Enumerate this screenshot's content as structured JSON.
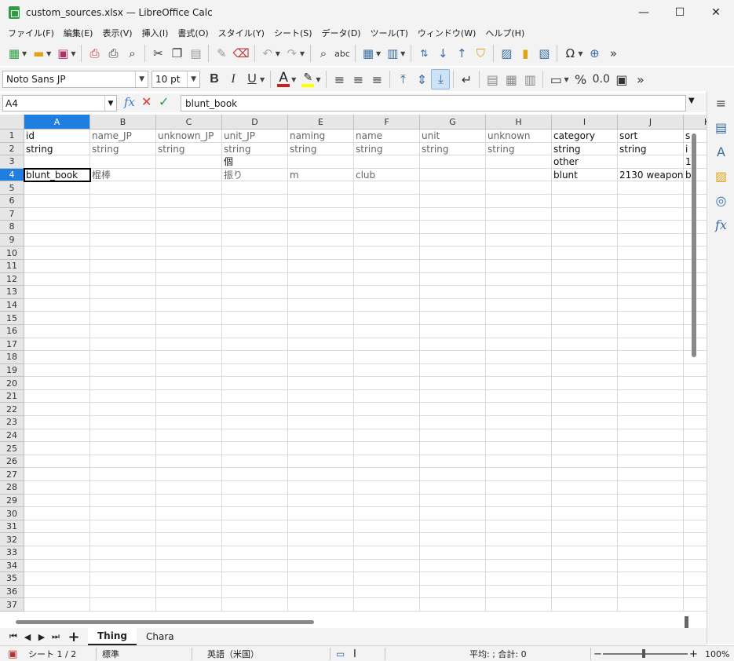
{
  "window": {
    "title": "custom_sources.xlsx — LibreOffice Calc",
    "minimize": "—",
    "maximize": "☐",
    "close": "✕"
  },
  "menu": [
    "ファイル(F)",
    "編集(E)",
    "表示(V)",
    "挿入(I)",
    "書式(O)",
    "スタイル(Y)",
    "シート(S)",
    "データ(D)",
    "ツール(T)",
    "ウィンドウ(W)",
    "ヘルプ(H)"
  ],
  "toolbar2": {
    "font_name": "Noto Sans JP",
    "font_size": "10 pt",
    "bold": "B",
    "italic": "I",
    "underline": "U",
    "font_color_letter": "A",
    "font_color": "#c9211e",
    "highlight_color": "#ffff00",
    "percent": "%",
    "decimal": "0.0"
  },
  "formula_bar": {
    "name_box": "A4",
    "content": "blunt_book"
  },
  "columns": [
    {
      "letter": "A",
      "selected": true
    },
    {
      "letter": "B",
      "selected": false
    },
    {
      "letter": "C",
      "selected": false
    },
    {
      "letter": "D",
      "selected": false
    },
    {
      "letter": "E",
      "selected": false
    },
    {
      "letter": "F",
      "selected": false
    },
    {
      "letter": "G",
      "selected": false
    },
    {
      "letter": "H",
      "selected": false
    },
    {
      "letter": "I",
      "selected": false
    },
    {
      "letter": "J",
      "selected": false
    },
    {
      "letter": "K",
      "selected": false
    }
  ],
  "rows_count": 37,
  "selected_row": 4,
  "cells": {
    "r1": [
      "id",
      "name_JP",
      "unknown_JP",
      "unit_JP",
      "naming",
      "name",
      "unit",
      "unknown",
      "category",
      "sort",
      "s"
    ],
    "r2": [
      "string",
      "string",
      "string",
      "string",
      "string",
      "string",
      "string",
      "string",
      "string",
      "string",
      "i"
    ],
    "r3": [
      "",
      "",
      "",
      "個",
      "",
      "",
      "",
      "",
      "other",
      "",
      "1"
    ],
    "r4": [
      "blunt_book",
      "棍棒",
      "",
      "振り",
      "m",
      "club",
      "",
      "",
      "blunt",
      "2130 weapon",
      "b"
    ]
  },
  "sheets": {
    "tabs": [
      "Thing",
      "Chara"
    ],
    "active": "Thing"
  },
  "status": {
    "sheet": "シート 1 / 2",
    "style": "標準",
    "language": "英語（米国）",
    "summary": "平均: ; 合計: 0",
    "zoom": "100%"
  }
}
